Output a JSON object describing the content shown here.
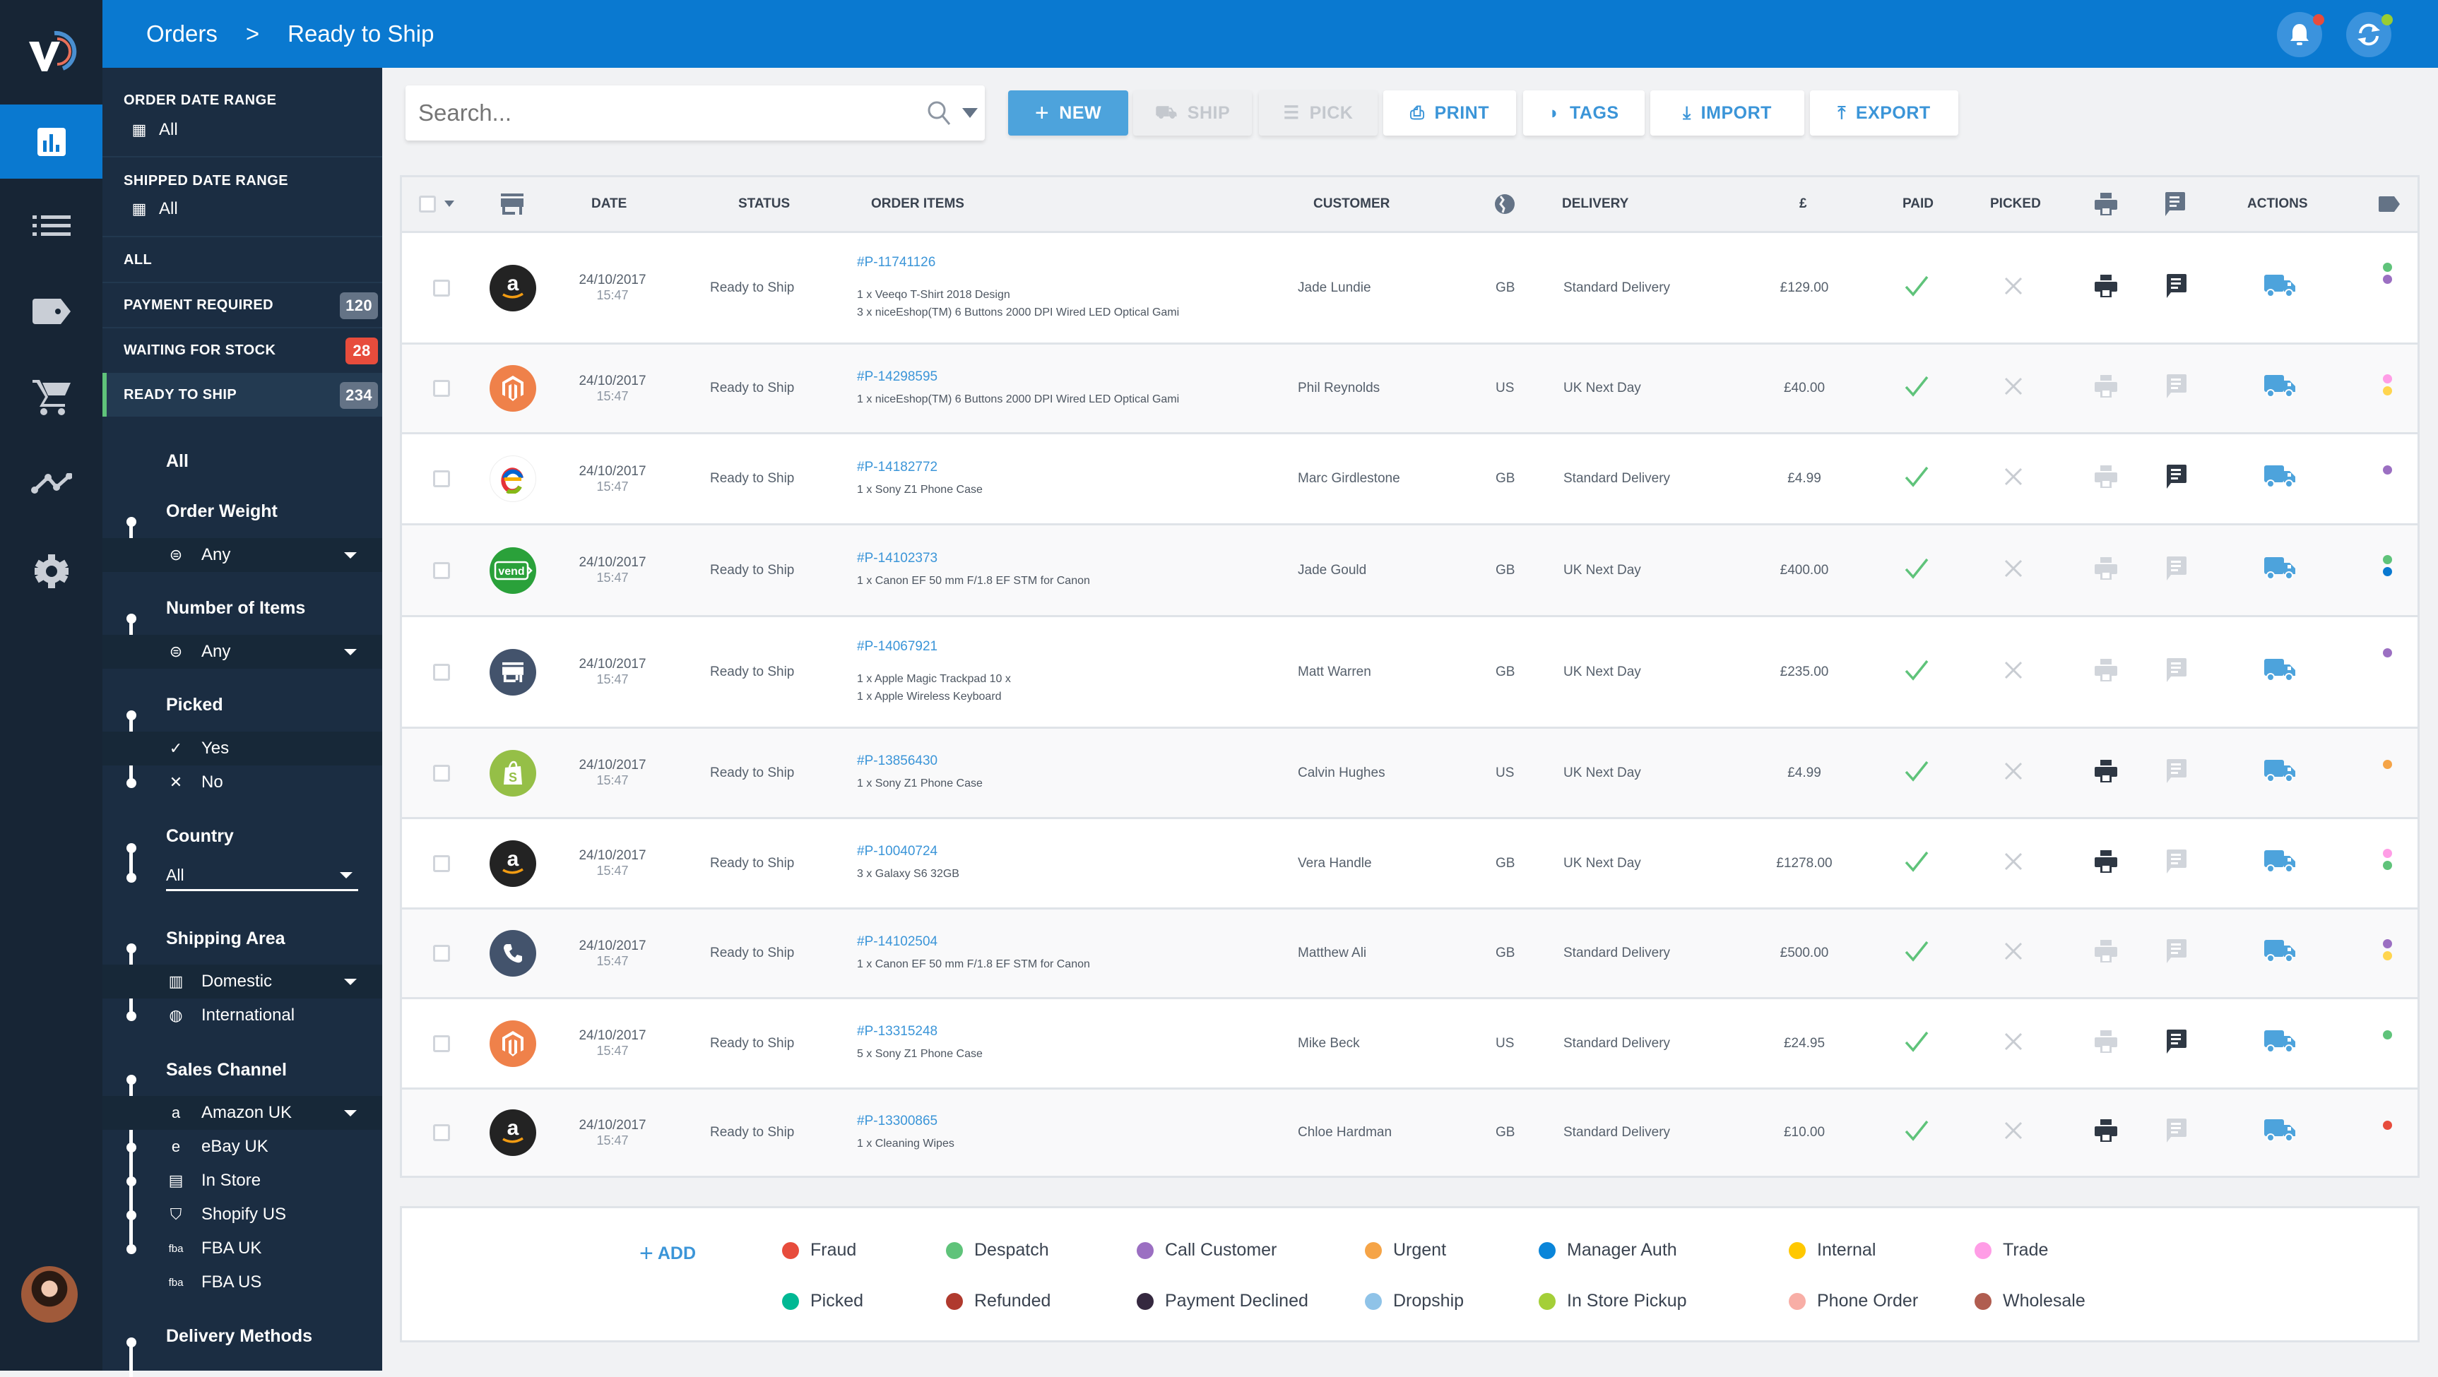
{
  "header": {
    "breadcrumb": [
      "Orders",
      ">",
      "Ready to Ship"
    ],
    "notification_dot_color": "#e74c3c",
    "sync_dot_color": "#9acd32"
  },
  "rail": {
    "items": [
      "dashboard-icon",
      "list-icon",
      "tag-icon",
      "cart-icon",
      "analytics-icon",
      "gear-icon"
    ]
  },
  "filters": {
    "order_date_range": {
      "label": "ORDER DATE RANGE",
      "value": "All"
    },
    "shipped_date_range": {
      "label": "SHIPPED DATE RANGE",
      "value": "All"
    },
    "statuses": [
      {
        "label": "ALL",
        "count": null
      },
      {
        "label": "PAYMENT REQUIRED",
        "count": "120",
        "badge_color": "#647386"
      },
      {
        "label": "WAITING FOR STOCK",
        "count": "28",
        "badge_color": "#e74c3c"
      },
      {
        "label": "READY TO SHIP",
        "count": "234",
        "badge_color": "#647386",
        "active": true
      }
    ],
    "all_label": "All",
    "order_weight": {
      "title": "Order Weight",
      "value": "Any"
    },
    "number_of_items": {
      "title": "Number of Items",
      "value": "Any"
    },
    "picked": {
      "title": "Picked",
      "options": [
        "Yes",
        "No"
      ],
      "selected": "Yes"
    },
    "country": {
      "title": "Country",
      "value": "All"
    },
    "shipping_area": {
      "title": "Shipping Area",
      "options": [
        "Domestic",
        "International"
      ],
      "selected": "Domestic"
    },
    "sales_channel": {
      "title": "Sales Channel",
      "options": [
        "Amazon UK",
        "eBay UK",
        "In Store",
        "Shopify US",
        "FBA UK",
        "FBA US"
      ],
      "selected": "Amazon UK"
    },
    "delivery_methods": {
      "title": "Delivery Methods"
    }
  },
  "toolbar": {
    "search_placeholder": "Search...",
    "buttons": [
      {
        "label": "NEW",
        "state": "primary"
      },
      {
        "label": "SHIP",
        "state": "disabled"
      },
      {
        "label": "PICK",
        "state": "disabled"
      },
      {
        "label": "PRINT",
        "state": "normal"
      },
      {
        "label": "TAGS",
        "state": "normal"
      },
      {
        "label": "IMPORT",
        "state": "normal"
      },
      {
        "label": "EXPORT",
        "state": "normal"
      }
    ]
  },
  "table": {
    "columns": [
      "DATE",
      "STATUS",
      "ORDER ITEMS",
      "CUSTOMER",
      "DELIVERY",
      "£",
      "PAID",
      "PICKED",
      "ACTIONS"
    ],
    "rows": [
      {
        "channel": "amazon",
        "date": "24/10/2017",
        "time": "15:47",
        "status": "Ready to Ship",
        "order": "#P-11741126",
        "items": [
          "1 x Veeqo T-Shirt 2018 Design",
          "3 x niceEshop(TM) 6 Buttons 2000 DPI Wired LED Optical Gami"
        ],
        "items_gap": true,
        "customer": "Jade Lundie",
        "country": "GB",
        "delivery": "Standard Delivery",
        "price": "£129.00",
        "paid": true,
        "picked": false,
        "printed": true,
        "note": true,
        "tags": [
          "#5fc37a",
          "#9b6fc2"
        ]
      },
      {
        "channel": "magento",
        "date": "24/10/2017",
        "time": "15:47",
        "status": "Ready to Ship",
        "order": "#P-14298595",
        "items": [
          "1 x niceEshop(TM) 6 Buttons 2000 DPI Wired LED Optical Gami"
        ],
        "customer": "Phil Reynolds",
        "country": "US",
        "delivery": "UK Next Day",
        "price": "£40.00",
        "paid": true,
        "picked": false,
        "printed": false,
        "note": false,
        "tags": [
          "#ff9de6",
          "#ffd54f"
        ]
      },
      {
        "channel": "ebay",
        "date": "24/10/2017",
        "time": "15:47",
        "status": "Ready to Ship",
        "order": "#P-14182772",
        "items": [
          "1 x Sony Z1 Phone Case"
        ],
        "customer": "Marc Girdlestone",
        "country": "GB",
        "delivery": "Standard Delivery",
        "price": "£4.99",
        "paid": true,
        "picked": false,
        "printed": false,
        "note": true,
        "tags": [
          "#9b6fc2"
        ]
      },
      {
        "channel": "vend",
        "date": "24/10/2017",
        "time": "15:47",
        "status": "Ready to Ship",
        "order": "#P-14102373",
        "items": [
          "1 x Canon EF 50 mm F/1.8 EF STM for Canon"
        ],
        "customer": "Jade Gould",
        "country": "GB",
        "delivery": "UK Next Day",
        "price": "£400.00",
        "paid": true,
        "picked": false,
        "printed": false,
        "note": false,
        "tags": [
          "#5fc37a",
          "#0a79d0"
        ]
      },
      {
        "channel": "store",
        "date": "24/10/2017",
        "time": "15:47",
        "status": "Ready to Ship",
        "order": "#P-14067921",
        "items": [
          "1 x Apple Magic Trackpad 10 x",
          "1 x Apple Wireless Keyboard"
        ],
        "items_gap": true,
        "customer": "Matt Warren",
        "country": "GB",
        "delivery": "UK Next Day",
        "price": "£235.00",
        "paid": true,
        "picked": false,
        "printed": false,
        "note": false,
        "tags": [
          "#9b6fc2"
        ]
      },
      {
        "channel": "shopify",
        "date": "24/10/2017",
        "time": "15:47",
        "status": "Ready to Ship",
        "order": "#P-13856430",
        "items": [
          "1 x Sony Z1 Phone Case"
        ],
        "customer": "Calvin Hughes",
        "country": "US",
        "delivery": "UK Next Day",
        "price": "£4.99",
        "paid": true,
        "picked": false,
        "printed": true,
        "note": false,
        "tags": [
          "#f5a447"
        ]
      },
      {
        "channel": "amazon",
        "date": "24/10/2017",
        "time": "15:47",
        "status": "Ready to Ship",
        "order": "#P-10040724",
        "items": [
          "3 x Galaxy S6 32GB"
        ],
        "customer": "Vera Handle",
        "country": "GB",
        "delivery": "UK Next Day",
        "price": "£1278.00",
        "paid": true,
        "picked": false,
        "printed": true,
        "note": false,
        "tags": [
          "#ff9de6",
          "#5fc37a"
        ]
      },
      {
        "channel": "phone",
        "date": "24/10/2017",
        "time": "15:47",
        "status": "Ready to Ship",
        "order": "#P-14102504",
        "items": [
          "1 x Canon EF 50 mm F/1.8 EF STM for Canon"
        ],
        "customer": "Matthew Ali",
        "country": "GB",
        "delivery": "Standard Delivery",
        "price": "£500.00",
        "paid": true,
        "picked": false,
        "printed": false,
        "note": false,
        "tags": [
          "#9b6fc2",
          "#ffd54f"
        ]
      },
      {
        "channel": "magento",
        "date": "24/10/2017",
        "time": "15:47",
        "status": "Ready to Ship",
        "order": "#P-13315248",
        "items": [
          "5 x Sony Z1 Phone Case"
        ],
        "customer": "Mike Beck",
        "country": "US",
        "delivery": "Standard Delivery",
        "price": "£24.95",
        "paid": true,
        "picked": false,
        "printed": false,
        "note": true,
        "tags": [
          "#5fc37a"
        ]
      },
      {
        "channel": "amazon",
        "date": "24/10/2017",
        "time": "15:47",
        "status": "Ready to Ship",
        "order": "#P-13300865",
        "items": [
          "1 x Cleaning Wipes"
        ],
        "customer": "Chloe Hardman",
        "country": "GB",
        "delivery": "Standard Delivery",
        "price": "£10.00",
        "paid": true,
        "picked": false,
        "printed": true,
        "note": false,
        "tags": [
          "#e74c3c"
        ]
      }
    ]
  },
  "legend": {
    "add_label": "ADD",
    "tags": [
      {
        "name": "Fraud",
        "color": "#e74c3c"
      },
      {
        "name": "Despatch",
        "color": "#5fc37a"
      },
      {
        "name": "Call Customer",
        "color": "#9b6fc2"
      },
      {
        "name": "Urgent",
        "color": "#f5a447"
      },
      {
        "name": "Manager Auth",
        "color": "#0a85d9"
      },
      {
        "name": "Internal",
        "color": "#ffc800"
      },
      {
        "name": "Trade",
        "color": "#ff9de6"
      },
      {
        "name": "Picked",
        "color": "#00b894"
      },
      {
        "name": "Refunded",
        "color": "#b03a2e"
      },
      {
        "name": "Payment Declined",
        "color": "#35283f"
      },
      {
        "name": "Dropship",
        "color": "#8fc3e8"
      },
      {
        "name": "In Store Pickup",
        "color": "#a4cf38"
      },
      {
        "name": "Phone Order",
        "color": "#f8aea6"
      },
      {
        "name": "Wholesale",
        "color": "#b05d50"
      }
    ]
  },
  "colors": {
    "brand_blue": "#0a79d0",
    "action_blue": "#4da3dc",
    "panel": "#1b2d42",
    "rail": "#172535"
  }
}
